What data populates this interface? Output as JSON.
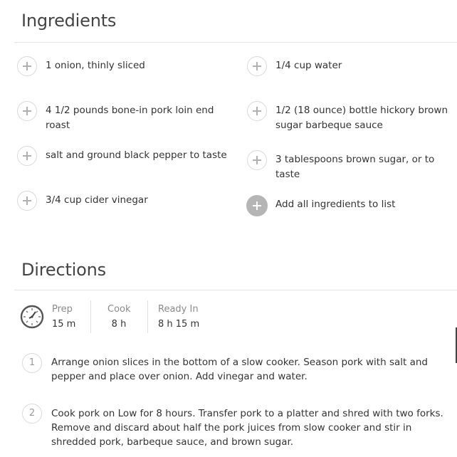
{
  "ingredients": {
    "title": "Ingredients",
    "items": [
      {
        "label": "1 onion, thinly sliced"
      },
      {
        "label": "4 1/2 pounds bone-in pork loin end roast"
      },
      {
        "label": "salt and ground black pepper to taste"
      },
      {
        "label": "3/4 cup cider vinegar"
      },
      {
        "label": "1/4 cup water"
      },
      {
        "label": "1/2 (18 ounce) bottle hickory brown sugar barbeque sauce"
      },
      {
        "label": "3 tablespoons brown sugar, or to taste"
      }
    ],
    "add_all_label": "Add all ingredients to list"
  },
  "directions": {
    "title": "Directions",
    "times": {
      "prep_label": "Prep",
      "prep_value": "15 m",
      "cook_label": "Cook",
      "cook_value": "8 h",
      "ready_label": "Ready In",
      "ready_value": "8 h 15 m"
    },
    "steps": [
      {
        "number": "1",
        "text": "Arrange onion slices in the bottom of a slow cooker. Season pork with salt and pepper and place over onion. Add vinegar and water."
      },
      {
        "number": "2",
        "text": "Cook pork on Low for 8 hours. Transfer pork to a platter and shred with two forks. Remove and discard about half the pork juices from slow cooker and stir in shredded pork, barbeque sauce, and brown sugar."
      }
    ]
  },
  "icons": {
    "add": "plus-icon",
    "timer": "clock-icon"
  },
  "colors": {
    "text": "#333333",
    "muted": "#8a8a8a",
    "circle_border": "#d9d9d9",
    "add_all_fill": "#b5b5b5"
  }
}
